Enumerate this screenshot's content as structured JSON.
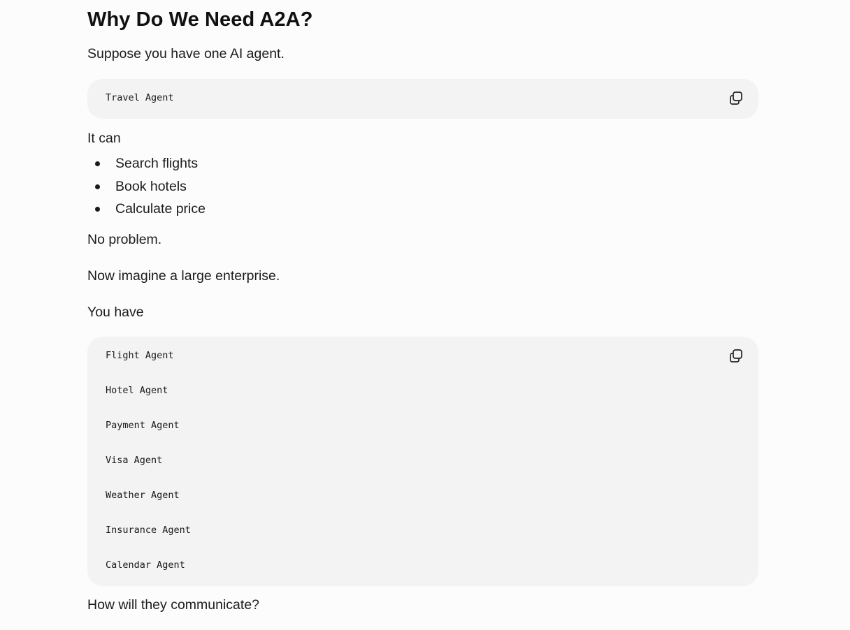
{
  "heading": "Why Do We Need A2A?",
  "intro": "Suppose you have one AI agent.",
  "code_block_1": {
    "lines": [
      "Travel Agent"
    ],
    "copy_icon": "copy-icon"
  },
  "it_can": "It can",
  "capabilities": [
    "Search flights",
    "Book hotels",
    "Calculate price"
  ],
  "no_problem": "No problem.",
  "imagine": "Now imagine a large enterprise.",
  "you_have": "You have",
  "code_block_2": {
    "lines": [
      "Flight Agent",
      "Hotel Agent",
      "Payment Agent",
      "Visa Agent",
      "Weather Agent",
      "Insurance Agent",
      "Calendar Agent"
    ],
    "copy_icon": "copy-icon"
  },
  "question": "How will they communicate?"
}
